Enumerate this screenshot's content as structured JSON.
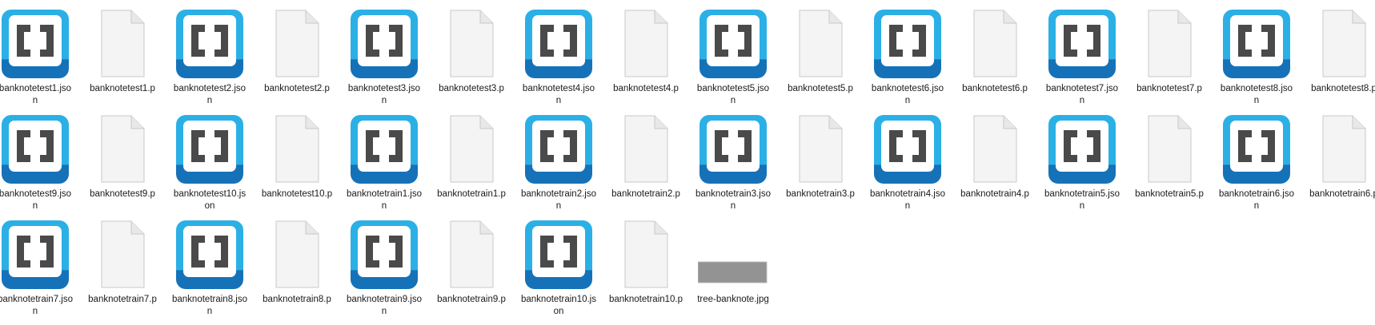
{
  "explorer": {
    "view": "large-icons",
    "files": [
      {
        "name": "banknotetest1.json",
        "type": "json",
        "icon": "brackets-json-icon"
      },
      {
        "name": "banknotetest1.p",
        "type": "file",
        "icon": "blank-file-icon"
      },
      {
        "name": "banknotetest2.json",
        "type": "json",
        "icon": "brackets-json-icon"
      },
      {
        "name": "banknotetest2.p",
        "type": "file",
        "icon": "blank-file-icon"
      },
      {
        "name": "banknotetest3.json",
        "type": "json",
        "icon": "brackets-json-icon"
      },
      {
        "name": "banknotetest3.p",
        "type": "file",
        "icon": "blank-file-icon"
      },
      {
        "name": "banknotetest4.json",
        "type": "json",
        "icon": "brackets-json-icon"
      },
      {
        "name": "banknotetest4.p",
        "type": "file",
        "icon": "blank-file-icon"
      },
      {
        "name": "banknotetest5.json",
        "type": "json",
        "icon": "brackets-json-icon"
      },
      {
        "name": "banknotetest5.p",
        "type": "file",
        "icon": "blank-file-icon"
      },
      {
        "name": "banknotetest6.json",
        "type": "json",
        "icon": "brackets-json-icon"
      },
      {
        "name": "banknotetest6.p",
        "type": "file",
        "icon": "blank-file-icon"
      },
      {
        "name": "banknotetest7.json",
        "type": "json",
        "icon": "brackets-json-icon"
      },
      {
        "name": "banknotetest7.p",
        "type": "file",
        "icon": "blank-file-icon"
      },
      {
        "name": "banknotetest8.json",
        "type": "json",
        "icon": "brackets-json-icon"
      },
      {
        "name": "banknotetest8.p",
        "type": "file",
        "icon": "blank-file-icon"
      },
      {
        "name": "banknotetest9.json",
        "type": "json",
        "icon": "brackets-json-icon"
      },
      {
        "name": "banknotetest9.p",
        "type": "file",
        "icon": "blank-file-icon"
      },
      {
        "name": "banknotetest10.json",
        "type": "json",
        "icon": "brackets-json-icon"
      },
      {
        "name": "banknotetest10.p",
        "type": "file",
        "icon": "blank-file-icon"
      },
      {
        "name": "banknotetrain1.json",
        "type": "json",
        "icon": "brackets-json-icon"
      },
      {
        "name": "banknotetrain1.p",
        "type": "file",
        "icon": "blank-file-icon"
      },
      {
        "name": "banknotetrain2.json",
        "type": "json",
        "icon": "brackets-json-icon"
      },
      {
        "name": "banknotetrain2.p",
        "type": "file",
        "icon": "blank-file-icon"
      },
      {
        "name": "banknotetrain3.json",
        "type": "json",
        "icon": "brackets-json-icon"
      },
      {
        "name": "banknotetrain3.p",
        "type": "file",
        "icon": "blank-file-icon"
      },
      {
        "name": "banknotetrain4.json",
        "type": "json",
        "icon": "brackets-json-icon"
      },
      {
        "name": "banknotetrain4.p",
        "type": "file",
        "icon": "blank-file-icon"
      },
      {
        "name": "banknotetrain5.json",
        "type": "json",
        "icon": "brackets-json-icon"
      },
      {
        "name": "banknotetrain5.p",
        "type": "file",
        "icon": "blank-file-icon"
      },
      {
        "name": "banknotetrain6.json",
        "type": "json",
        "icon": "brackets-json-icon"
      },
      {
        "name": "banknotetrain6.p",
        "type": "file",
        "icon": "blank-file-icon"
      },
      {
        "name": "banknotetrain7.json",
        "type": "json",
        "icon": "brackets-json-icon"
      },
      {
        "name": "banknotetrain7.p",
        "type": "file",
        "icon": "blank-file-icon"
      },
      {
        "name": "banknotetrain8.json",
        "type": "json",
        "icon": "brackets-json-icon"
      },
      {
        "name": "banknotetrain8.p",
        "type": "file",
        "icon": "blank-file-icon"
      },
      {
        "name": "banknotetrain9.json",
        "type": "json",
        "icon": "brackets-json-icon"
      },
      {
        "name": "banknotetrain9.p",
        "type": "file",
        "icon": "blank-file-icon"
      },
      {
        "name": "banknotetrain10.json",
        "type": "json",
        "icon": "brackets-json-icon"
      },
      {
        "name": "banknotetrain10.p",
        "type": "file",
        "icon": "blank-file-icon"
      },
      {
        "name": "tree-banknote.jpg",
        "type": "image",
        "icon": "image-thumbnail-icon"
      }
    ]
  },
  "colors": {
    "json_icon_top": "#2bb0e6",
    "json_icon_bottom": "#1672b8",
    "bracket_gray": "#4a4a4a",
    "blank_file_fill": "#f4f4f4",
    "blank_file_border": "#c9c9c9",
    "thumbnail_gray": "#8a8a8a"
  }
}
